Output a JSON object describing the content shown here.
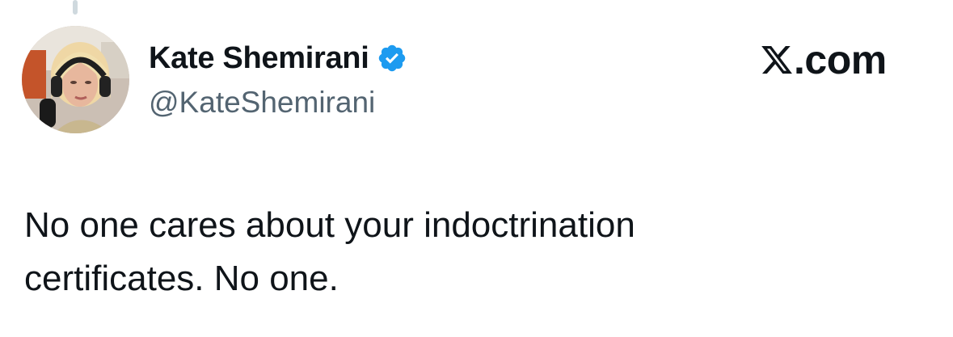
{
  "author": {
    "display_name": "Kate Shemirani",
    "handle": "@KateShemirani",
    "verified": true,
    "avatar_icon": "profile-photo"
  },
  "brand": {
    "label": ".com",
    "logo_icon": "x-logo-icon"
  },
  "tweet": {
    "lines": [
      "No one cares about your indoctrination",
      "certificates. No one."
    ]
  },
  "colors": {
    "text_primary": "#0f1419",
    "text_secondary": "#536471",
    "verified_blue": "#1d9bf0",
    "thread_line": "#cfd9de"
  }
}
